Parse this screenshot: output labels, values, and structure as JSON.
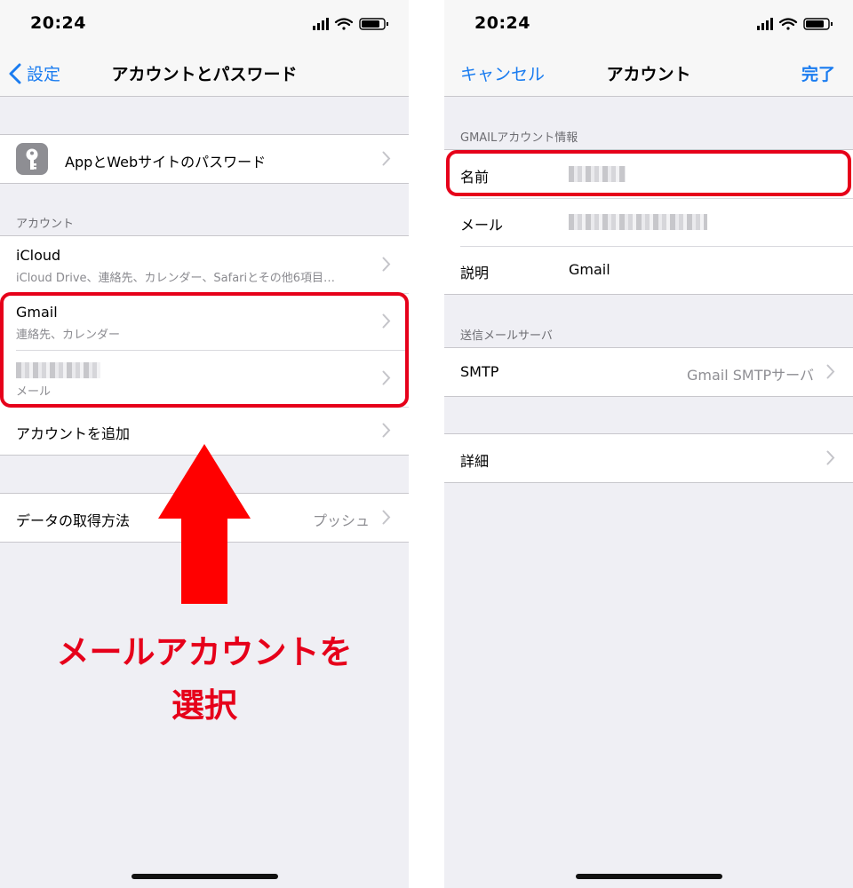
{
  "left": {
    "status_time": "20:24",
    "back_label": "設定",
    "title": "アカウントとパスワード",
    "passwords_row": "AppとWebサイトのパスワード",
    "accounts_header": "アカウント",
    "accounts": [
      {
        "title": "iCloud",
        "subtitle": "iCloud Drive、連絡先、カレンダー、Safariとその他6項目…"
      },
      {
        "title": "Gmail",
        "subtitle": "連絡先、カレンダー"
      },
      {
        "title": "",
        "subtitle": "メール"
      }
    ],
    "add_account": "アカウントを追加",
    "fetch_label": "データの取得方法",
    "fetch_value": "プッシュ",
    "annotation_line1": "メールアカウントを",
    "annotation_line2": "選択"
  },
  "right": {
    "status_time": "20:24",
    "cancel": "キャンセル",
    "title": "アカウント",
    "done": "完了",
    "info_header": "GMAILアカウント情報",
    "fields": [
      {
        "label": "名前",
        "value": ""
      },
      {
        "label": "メール",
        "value": ""
      },
      {
        "label": "説明",
        "value": "Gmail"
      }
    ],
    "smtp_header": "送信メールサーバ",
    "smtp_label": "SMTP",
    "smtp_value": "Gmail SMTPサーバ",
    "advanced": "詳細"
  },
  "colors": {
    "accent": "#1a7cf0",
    "highlight": "#e6001a",
    "background": "#efeff4"
  }
}
